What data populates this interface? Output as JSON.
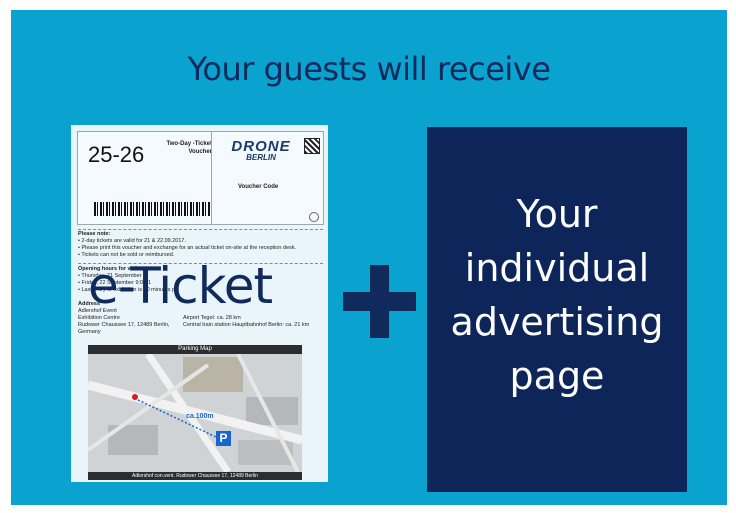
{
  "headline": "Your guests will receive",
  "ticket": {
    "number": "25-26",
    "type_line1": "Two-Day -Ticket",
    "type_line2": "Voucher",
    "logo_top": "DRONE",
    "logo_bottom": "BERLIN",
    "voucher_code_label": "Voucher Code",
    "please_note_title": "Please note:",
    "note1": "• 2-day tickets are valid for 21 & 22.09.2017.",
    "note2": "• Please print this voucher and exchange for an actual ticket on-site at the reception desk.",
    "note3": "• Tickets can not be sold or reimbursed.",
    "opening_title": "Opening hours for visitors:",
    "open1": "• Thursday, 21 September",
    "open2": "• Friday, 22 September 9:00-1",
    "open3": "• Last entry to exhibition is 60 minutes p",
    "addr_title": "Address",
    "addr1": "Adlershof Event",
    "addr2": "Exhibition Centre",
    "addr3": "Rudower Chaussee 17, 12489 Berlin,",
    "addr4": "Germany",
    "travel1": "Airport Tegel: ca. 28 km",
    "travel2": "Central train station Hauptbahnhof Berlin: ca. 21 km",
    "map_title": "Parking Map",
    "map_distance": "ca.100m",
    "map_parking": "P",
    "map_footer": "Adlershof con.vent. Rudower Chaussee 17, 12489 Berlin"
  },
  "eticket_label": "e-Ticket",
  "ad_text": [
    "Your",
    "individual",
    "advertising",
    "page"
  ]
}
